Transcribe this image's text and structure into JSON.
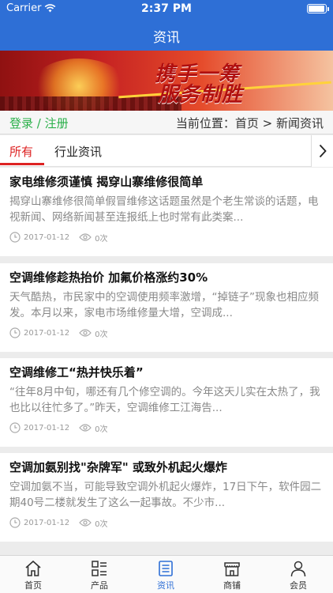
{
  "status_bar": {
    "carrier": "Carrier",
    "time": "2:37 PM"
  },
  "header": {
    "title": "资讯"
  },
  "banner": {
    "slogan_line1": "携手一筹",
    "slogan_line2": "服务制胜"
  },
  "location_bar": {
    "login_text": "登录 / 注册",
    "location_text": "当前位置：首页 > 新闻资讯"
  },
  "tabs": [
    {
      "label": "所有",
      "active": true
    },
    {
      "label": "行业资讯",
      "active": false
    }
  ],
  "news": [
    {
      "title": "家电维修须谨慎 揭穿山寨维修很简单",
      "summary": "揭穿山寨维修很简单假冒维修这话题虽然是个老生常谈的话题，电视新闻、网络新闻甚至连报纸上也时常有此类案...",
      "date": "2017-01-12",
      "views": "0次"
    },
    {
      "title": "空调维修趁热抬价 加氟价格涨约30%",
      "summary": "天气酷热，市民家中的空调使用频率激增，“掉链子”现象也相应频发。本月以来，家电市场维修量大增，空调成...",
      "date": "2017-01-12",
      "views": "0次"
    },
    {
      "title": "空调维修工“热并快乐着”",
      "summary": "“往年8月中旬，哪还有几个修空调的。今年这天儿实在太热了，我也比以往忙多了。”昨天，空调维修工江海告...",
      "date": "2017-01-12",
      "views": "0次"
    },
    {
      "title": "空调加氨别找\"杂牌军\" 或致外机起火爆炸",
      "summary": "空调加氨不当，可能导致空调外机起火爆炸，17日下午，软件园二期40号二楼就发生了这么一起事故。不少市...",
      "date": "2017-01-12",
      "views": "0次"
    }
  ],
  "tabbar": [
    {
      "label": "首页",
      "icon": "home-icon",
      "active": false
    },
    {
      "label": "产品",
      "icon": "product-list-icon",
      "active": false
    },
    {
      "label": "资讯",
      "icon": "news-icon",
      "active": true
    },
    {
      "label": "商铺",
      "icon": "shop-icon",
      "active": false
    },
    {
      "label": "会员",
      "icon": "member-icon",
      "active": false
    }
  ],
  "colors": {
    "header_bg": "#2e6fd6",
    "accent_red": "#dd2222",
    "login_green": "#2bb04a",
    "active_tab_blue": "#2e6fd6"
  }
}
